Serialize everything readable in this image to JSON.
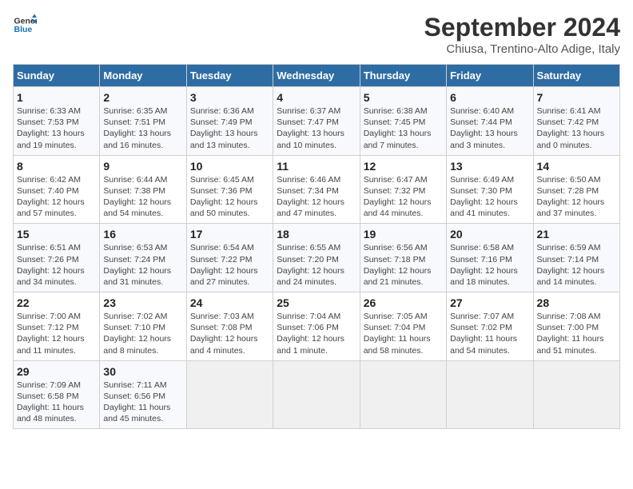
{
  "logo": {
    "line1": "General",
    "line2": "Blue"
  },
  "title": "September 2024",
  "subtitle": "Chiusa, Trentino-Alto Adige, Italy",
  "headers": [
    "Sunday",
    "Monday",
    "Tuesday",
    "Wednesday",
    "Thursday",
    "Friday",
    "Saturday"
  ],
  "weeks": [
    [
      {
        "day": "1",
        "rise": "6:33 AM",
        "set": "7:53 PM",
        "daylight": "13 hours and 19 minutes."
      },
      {
        "day": "2",
        "rise": "6:35 AM",
        "set": "7:51 PM",
        "daylight": "13 hours and 16 minutes."
      },
      {
        "day": "3",
        "rise": "6:36 AM",
        "set": "7:49 PM",
        "daylight": "13 hours and 13 minutes."
      },
      {
        "day": "4",
        "rise": "6:37 AM",
        "set": "7:47 PM",
        "daylight": "13 hours and 10 minutes."
      },
      {
        "day": "5",
        "rise": "6:38 AM",
        "set": "7:45 PM",
        "daylight": "13 hours and 7 minutes."
      },
      {
        "day": "6",
        "rise": "6:40 AM",
        "set": "7:44 PM",
        "daylight": "13 hours and 3 minutes."
      },
      {
        "day": "7",
        "rise": "6:41 AM",
        "set": "7:42 PM",
        "daylight": "13 hours and 0 minutes."
      }
    ],
    [
      {
        "day": "8",
        "rise": "6:42 AM",
        "set": "7:40 PM",
        "daylight": "12 hours and 57 minutes."
      },
      {
        "day": "9",
        "rise": "6:44 AM",
        "set": "7:38 PM",
        "daylight": "12 hours and 54 minutes."
      },
      {
        "day": "10",
        "rise": "6:45 AM",
        "set": "7:36 PM",
        "daylight": "12 hours and 50 minutes."
      },
      {
        "day": "11",
        "rise": "6:46 AM",
        "set": "7:34 PM",
        "daylight": "12 hours and 47 minutes."
      },
      {
        "day": "12",
        "rise": "6:47 AM",
        "set": "7:32 PM",
        "daylight": "12 hours and 44 minutes."
      },
      {
        "day": "13",
        "rise": "6:49 AM",
        "set": "7:30 PM",
        "daylight": "12 hours and 41 minutes."
      },
      {
        "day": "14",
        "rise": "6:50 AM",
        "set": "7:28 PM",
        "daylight": "12 hours and 37 minutes."
      }
    ],
    [
      {
        "day": "15",
        "rise": "6:51 AM",
        "set": "7:26 PM",
        "daylight": "12 hours and 34 minutes."
      },
      {
        "day": "16",
        "rise": "6:53 AM",
        "set": "7:24 PM",
        "daylight": "12 hours and 31 minutes."
      },
      {
        "day": "17",
        "rise": "6:54 AM",
        "set": "7:22 PM",
        "daylight": "12 hours and 27 minutes."
      },
      {
        "day": "18",
        "rise": "6:55 AM",
        "set": "7:20 PM",
        "daylight": "12 hours and 24 minutes."
      },
      {
        "day": "19",
        "rise": "6:56 AM",
        "set": "7:18 PM",
        "daylight": "12 hours and 21 minutes."
      },
      {
        "day": "20",
        "rise": "6:58 AM",
        "set": "7:16 PM",
        "daylight": "12 hours and 18 minutes."
      },
      {
        "day": "21",
        "rise": "6:59 AM",
        "set": "7:14 PM",
        "daylight": "12 hours and 14 minutes."
      }
    ],
    [
      {
        "day": "22",
        "rise": "7:00 AM",
        "set": "7:12 PM",
        "daylight": "12 hours and 11 minutes."
      },
      {
        "day": "23",
        "rise": "7:02 AM",
        "set": "7:10 PM",
        "daylight": "12 hours and 8 minutes."
      },
      {
        "day": "24",
        "rise": "7:03 AM",
        "set": "7:08 PM",
        "daylight": "12 hours and 4 minutes."
      },
      {
        "day": "25",
        "rise": "7:04 AM",
        "set": "7:06 PM",
        "daylight": "12 hours and 1 minute."
      },
      {
        "day": "26",
        "rise": "7:05 AM",
        "set": "7:04 PM",
        "daylight": "11 hours and 58 minutes."
      },
      {
        "day": "27",
        "rise": "7:07 AM",
        "set": "7:02 PM",
        "daylight": "11 hours and 54 minutes."
      },
      {
        "day": "28",
        "rise": "7:08 AM",
        "set": "7:00 PM",
        "daylight": "11 hours and 51 minutes."
      }
    ],
    [
      {
        "day": "29",
        "rise": "7:09 AM",
        "set": "6:58 PM",
        "daylight": "11 hours and 48 minutes."
      },
      {
        "day": "30",
        "rise": "7:11 AM",
        "set": "6:56 PM",
        "daylight": "11 hours and 45 minutes."
      },
      null,
      null,
      null,
      null,
      null
    ]
  ]
}
